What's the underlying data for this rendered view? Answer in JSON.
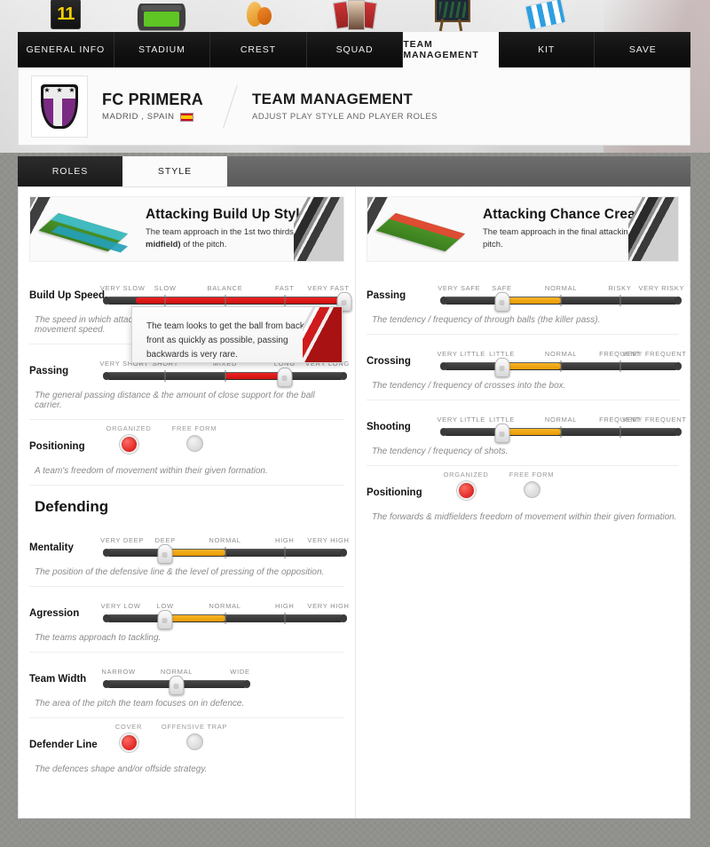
{
  "topnav": {
    "tabs": [
      {
        "label": "GENERAL INFO",
        "icon": "jersey-number-icon",
        "active": false
      },
      {
        "label": "STADIUM",
        "icon": "stadium-icon",
        "active": false
      },
      {
        "label": "CREST",
        "icon": "crest-icon",
        "active": false
      },
      {
        "label": "SQUAD",
        "icon": "squad-photos-icon",
        "active": false
      },
      {
        "label": "TEAM MANAGEMENT",
        "icon": "tactics-board-icon",
        "active": true
      },
      {
        "label": "KIT",
        "icon": "kit-icon",
        "active": false
      },
      {
        "label": "SAVE",
        "icon": "save-icon",
        "active": false
      }
    ]
  },
  "club": {
    "name": "FC PRIMERA",
    "location": "MADRID , SPAIN",
    "flag": "spain-flag-icon",
    "section_title": "TEAM MANAGEMENT",
    "section_subtitle": "ADJUST PLAY STYLE AND PLAYER ROLES"
  },
  "subtabs": [
    {
      "label": "ROLES",
      "active": false
    },
    {
      "label": "STYLE",
      "active": true
    }
  ],
  "tooltip": {
    "text": "The team looks to get the ball from back to front as quickly as possible, passing backwards is very rare."
  },
  "left": {
    "header": {
      "title": "Attacking Build Up Style",
      "desc_pre": "The team approach in the 1st two thirds ",
      "desc_bold": "(defence, midfield)",
      "desc_post": " of the pitch.",
      "pitch_icon": "build-up-pitch-icon"
    },
    "controls": [
      {
        "name": "build-up-speed",
        "label": "Build Up Speed",
        "type": "slider",
        "ticks": [
          "VERY SLOW",
          "SLOW",
          "BALANCE",
          "FAST",
          "VERY FAST"
        ],
        "value_index": 4,
        "fill_from": 0.5,
        "fill_color": "red",
        "help": "The speed in which attacks are made. This is not passing distance, but movement speed."
      },
      {
        "name": "passing",
        "label": "Passing",
        "type": "slider",
        "ticks": [
          "VERY SHORT",
          "SHORT",
          "MIXED",
          "LONG",
          "VERY LONG"
        ],
        "value_index": 3,
        "fill_from": 2,
        "fill_color": "red",
        "help": "The general passing distance & the amount of close support for the ball carrier."
      },
      {
        "name": "positioning",
        "label": "Positioning",
        "type": "radio",
        "options": [
          "ORGANIZED",
          "FREE FORM"
        ],
        "selected": 0,
        "help": "A team's freedom of movement within their given formation."
      }
    ],
    "defending_heading": "Defending",
    "defending_controls": [
      {
        "name": "mentality",
        "label": "Mentality",
        "type": "slider",
        "ticks": [
          "VERY DEEP",
          "DEEP",
          "NORMAL",
          "HIGH",
          "VERY HIGH"
        ],
        "value_index": 1,
        "fill_from": 1,
        "fill_to": 2,
        "fill_color": "orange",
        "help": "The position of the defensive line & the level of pressing of the opposition."
      },
      {
        "name": "agression",
        "label": "Agression",
        "type": "slider",
        "ticks": [
          "VERY LOW",
          "LOW",
          "NORMAL",
          "HIGH",
          "VERY HIGH"
        ],
        "value_index": 1,
        "fill_from": 1,
        "fill_to": 2,
        "fill_color": "orange",
        "help": "The teams approach to tackling."
      },
      {
        "name": "team-width",
        "label": "Team Width",
        "type": "slider",
        "short": true,
        "ticks": [
          "NARROW",
          "NORMAL",
          "WIDE"
        ],
        "value_index": 1,
        "fill_color": "none",
        "help": "The area of the pitch the team focuses on in defence."
      },
      {
        "name": "defender-line",
        "label": "Defender Line",
        "type": "radio",
        "options": [
          "COVER",
          "OFFENSIVE TRAP"
        ],
        "selected": 0,
        "help": "The defences shape and/or offside strategy."
      }
    ]
  },
  "right": {
    "header": {
      "title": "Attacking Chance Creation",
      "desc_pre": "The team approach in the final attacking third of the pitch.",
      "desc_bold": "",
      "desc_post": "",
      "pitch_icon": "chance-creation-pitch-icon"
    },
    "controls": [
      {
        "name": "chance-passing",
        "label": "Passing",
        "type": "slider",
        "ticks": [
          "VERY SAFE",
          "SAFE",
          "NORMAL",
          "RISKY",
          "VERY RISKY"
        ],
        "value_index": 1,
        "fill_from": 1,
        "fill_to": 2,
        "fill_color": "orange",
        "help": "The tendency / frequency of through balls (the killer pass)."
      },
      {
        "name": "crossing",
        "label": "Crossing",
        "type": "slider",
        "ticks": [
          "VERY LITTLE",
          "LITTLE",
          "NORMAL",
          "FREQUENT",
          "VERY FREQUENT"
        ],
        "value_index": 1,
        "fill_from": 1,
        "fill_to": 2,
        "fill_color": "orange",
        "help": "The tendency / frequency of crosses into the box."
      },
      {
        "name": "shooting",
        "label": "Shooting",
        "type": "slider",
        "ticks": [
          "VERY LITTLE",
          "LITTLE",
          "NORMAL",
          "FREQUENT",
          "VERY FREQUENT"
        ],
        "value_index": 1,
        "fill_from": 1,
        "fill_to": 2,
        "fill_color": "orange",
        "help": "The tendency / frequency of shots."
      },
      {
        "name": "chance-positioning",
        "label": "Positioning",
        "type": "radio",
        "options": [
          "ORGANIZED",
          "FREE FORM"
        ],
        "selected": 0,
        "help": "The forwards & midfielders freedom of movement within their given formation."
      }
    ]
  },
  "colors": {
    "accent_red": "#d50c0c",
    "accent_orange": "#e89a05",
    "crest_purple": "#7b2a84",
    "nav_dark": "#121212"
  }
}
